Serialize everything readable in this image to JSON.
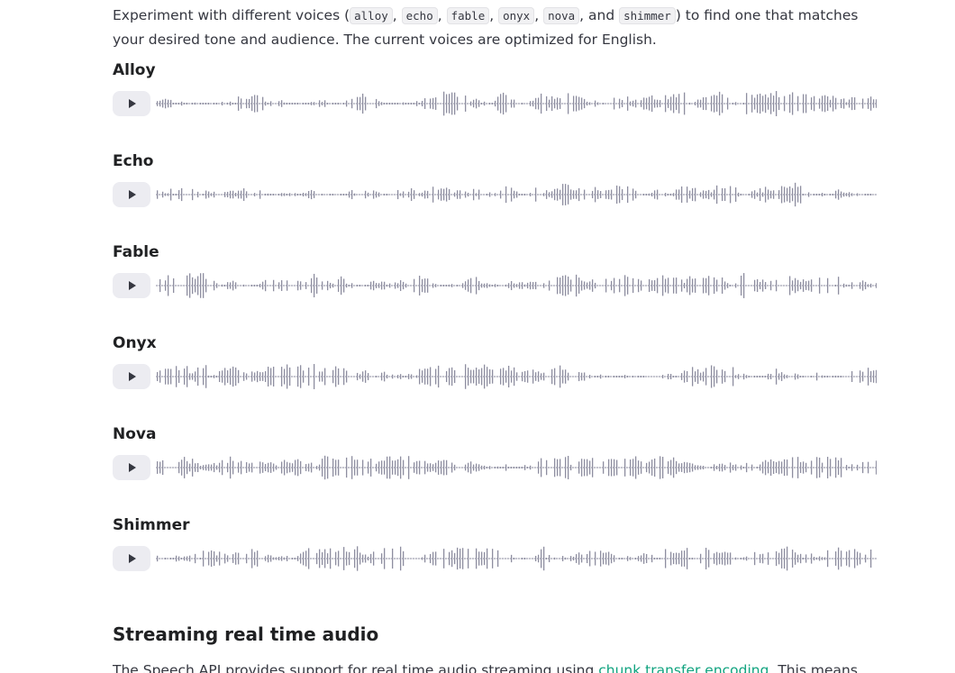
{
  "intro": {
    "text_before": "Experiment with different voices (",
    "codes": [
      "alloy",
      "echo",
      "fable",
      "onyx",
      "nova",
      "shimmer"
    ],
    "sep": ", ",
    "and": ", and ",
    "text_after": ") to find one that matches your desired tone and audience. The current voices are optimized for English."
  },
  "voices": [
    {
      "name": "Alloy"
    },
    {
      "name": "Echo"
    },
    {
      "name": "Fable"
    },
    {
      "name": "Onyx"
    },
    {
      "name": "Nova"
    },
    {
      "name": "Shimmer"
    }
  ],
  "section": {
    "heading": "Streaming real time audio",
    "para_before": "The Speech API provides support for real time audio streaming using ",
    "link_text": "chunk transfer encoding",
    "para_after": ". This means that the audio is able to be played before the full file has been generated and made accessible."
  },
  "colors": {
    "accent_link": "#10a37f",
    "waveform": "#8e8ea0",
    "button_bg": "#ececf1"
  },
  "icons": {
    "play": "play-icon"
  }
}
